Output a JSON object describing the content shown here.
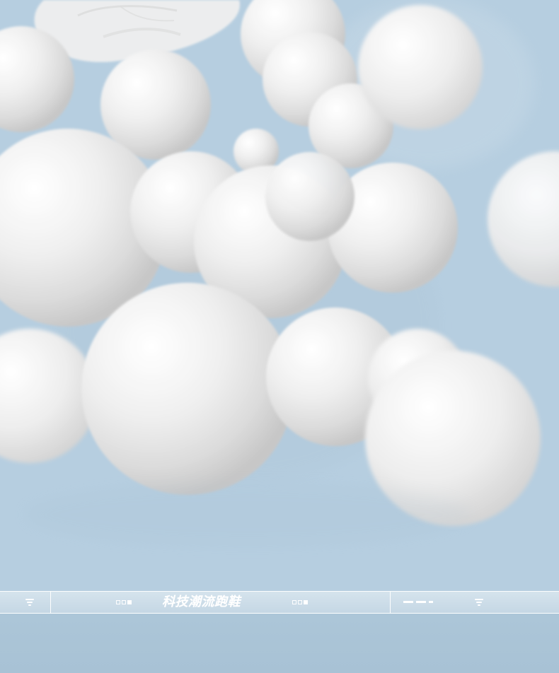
{
  "hero": {
    "background_color": "#b6cee0",
    "bubble_color": "#e8e8e8"
  },
  "info_bar": {
    "title": "科技潮流跑鞋",
    "accent_color": "#ffffff",
    "left_icon": "filter-icon",
    "right_icon": "filter-icon",
    "center_left_icon": "mini-squares-icon",
    "center_right_icon": "mini-squares-icon",
    "right_dash_icon": "dash-icon"
  }
}
